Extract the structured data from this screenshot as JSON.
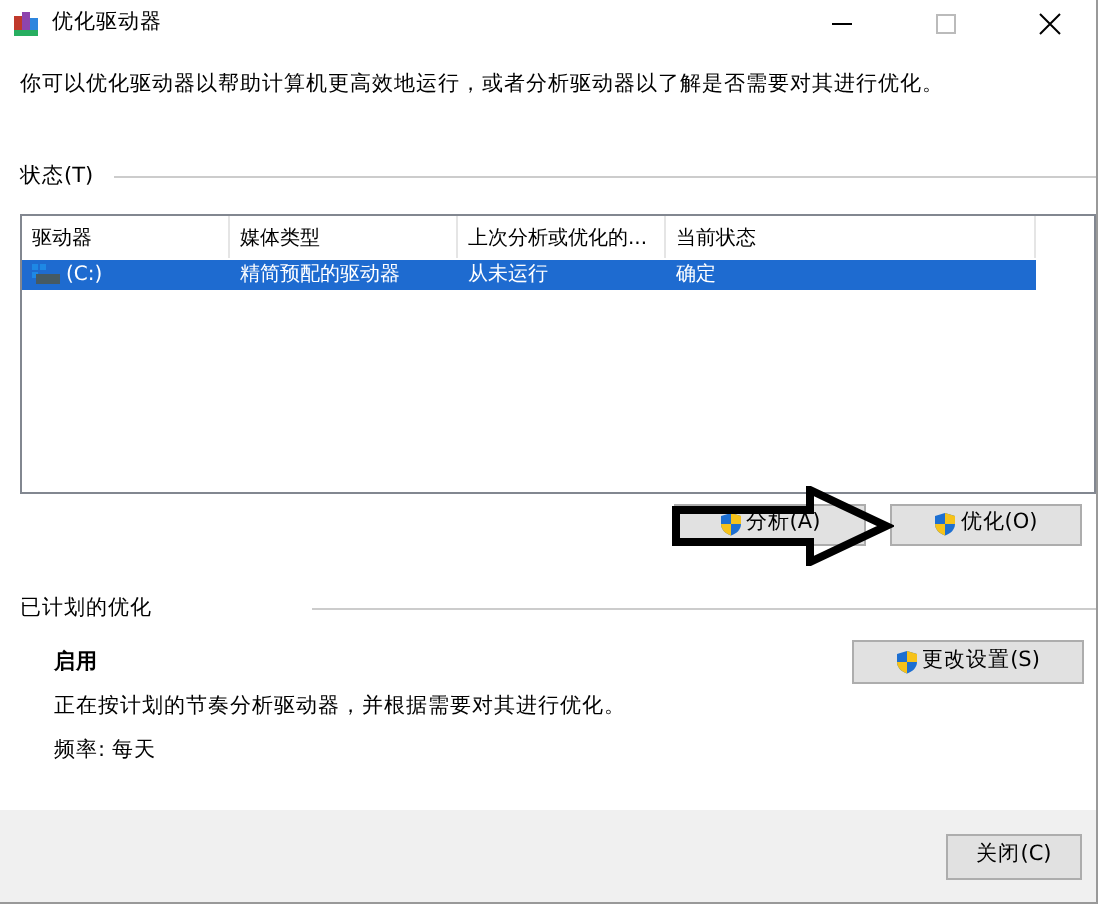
{
  "window": {
    "title": "优化驱动器"
  },
  "description": "你可以优化驱动器以帮助计算机更高效地运行，或者分析驱动器以了解是否需要对其进行优化。",
  "status": {
    "label": "状态(T)",
    "columns": [
      "驱动器",
      "媒体类型",
      "上次分析或优化的...",
      "当前状态"
    ],
    "rows": [
      {
        "cells": [
          "(C:)",
          "精简预配的驱动器",
          "从未运行",
          "确定"
        ],
        "selected": true
      }
    ]
  },
  "actions": [
    {
      "label": "分析(A)"
    },
    {
      "label": "优化(O)"
    }
  ],
  "schedule": {
    "label": "已计划的优化",
    "state": "启用",
    "text": "正在按计划的节奏分析驱动器，并根据需要对其进行优化。",
    "frequency": "频率: 每天",
    "button": "更改设置(S)"
  },
  "close_button": "关闭(C)"
}
